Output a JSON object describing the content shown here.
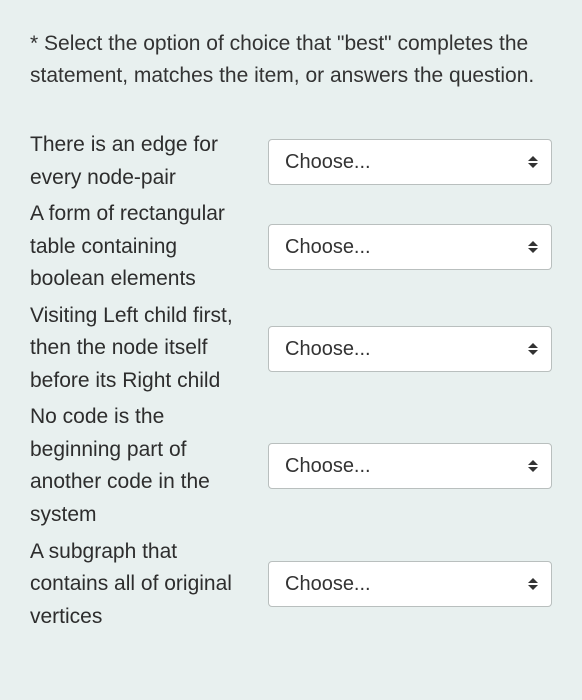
{
  "instruction": "* Select the option of choice that \"best\" completes the statement, matches the item, or answers the question.",
  "placeholder": "Choose...",
  "items": [
    {
      "prompt": "There is an edge for every node-pair",
      "selected": "Choose..."
    },
    {
      "prompt": "A form of rectangular table containing boolean elements",
      "selected": "Choose..."
    },
    {
      "prompt": "Visiting Left child first, then the node itself before its Right child",
      "selected": "Choose..."
    },
    {
      "prompt": "No code is the beginning part of another code in the system",
      "selected": "Choose..."
    },
    {
      "prompt": "A subgraph that contains all of original vertices",
      "selected": "Choose..."
    }
  ]
}
